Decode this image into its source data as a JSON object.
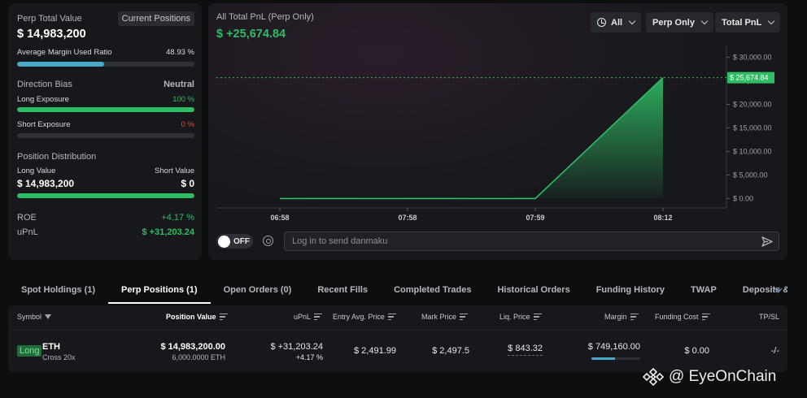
{
  "left_panel": {
    "perp_total_label": "Perp Total Value",
    "current_positions_btn": "Current Positions",
    "perp_total_value": "$ 14,983,200",
    "margin_label": "Average Margin Used Ratio",
    "margin_value": "48.93 %",
    "margin_ratio": 0.4893,
    "direction_bias_label": "Direction Bias",
    "direction_bias_value": "Neutral",
    "long_exposure_label": "Long Exposure",
    "long_exposure_value": "100 %",
    "long_exposure_ratio": 1.0,
    "short_exposure_label": "Short Exposure",
    "short_exposure_value": "0 %",
    "short_exposure_ratio": 0.0,
    "position_distribution_label": "Position Distribution",
    "long_value_label": "Long Value",
    "short_value_label": "Short Value",
    "long_value": "$ 14,983,200",
    "short_value": "$ 0",
    "long_value_ratio": 1.0,
    "roe_label": "ROE",
    "roe_value": "+4.17 %",
    "upnl_label": "uPnL",
    "upnl_value": "$ +31,203.24"
  },
  "chart_panel": {
    "title": "All Total PnL (Perp Only)",
    "value": "$ +25,674.84",
    "filters": [
      {
        "label": "All",
        "icon": "clock-icon"
      },
      {
        "label": "Perp Only"
      },
      {
        "label": "Total PnL"
      }
    ],
    "current_marker_label": "$ 25,674.84",
    "toggle_label": "OFF",
    "danmaku_placeholder": "Log in to send danmaku"
  },
  "chart_data": {
    "type": "area",
    "x": [
      "06:58",
      "07:58",
      "07:59",
      "08:12"
    ],
    "series": [
      {
        "values": [
          0,
          0,
          0,
          25674.84
        ]
      }
    ],
    "y_ticks": [
      "$ 30,000.00",
      "$ 25,000.00",
      "$ 20,000.00",
      "$ 15,000.00",
      "$ 10,000.00",
      "$ 5,000.00",
      "$ 0.00"
    ],
    "y_tick_values": [
      30000,
      25000,
      20000,
      15000,
      10000,
      5000,
      0
    ],
    "x_ticks": [
      "06:58",
      "07:58",
      "07:59",
      "08:12"
    ],
    "ylim": [
      -2000,
      32500
    ],
    "current_value": 25674.84,
    "colors": {
      "line": "#2ebd63",
      "area": "#2ebd63"
    }
  },
  "tabs": [
    {
      "label": "Spot Holdings (1)",
      "active": false
    },
    {
      "label": "Perp Positions (1)",
      "active": true
    },
    {
      "label": "Open Orders (0)",
      "active": false
    },
    {
      "label": "Recent Fills",
      "active": false
    },
    {
      "label": "Completed Trades",
      "active": false
    },
    {
      "label": "Historical Orders",
      "active": false
    },
    {
      "label": "Funding History",
      "active": false
    },
    {
      "label": "TWAP",
      "active": false
    },
    {
      "label": "Deposits & Withdrav",
      "active": false
    }
  ],
  "table": {
    "headers": {
      "symbol": "Symbol",
      "position_value": "Position Value",
      "upnl": "uPnL",
      "entry": "Entry Avg. Price",
      "mark": "Mark Price",
      "liq": "Liq. Price",
      "margin": "Margin",
      "funding": "Funding Cost",
      "tpsl": "TP/SL"
    },
    "row": {
      "side": "Long",
      "symbol": "ETH",
      "leverage": "Cross 20x",
      "position_value": "$ 14,983,200.00",
      "position_size": "6,000.0000 ETH",
      "upnl": "$ +31,203.24",
      "upnl_pct": "+4.17 %",
      "entry": "$ 2,491.99",
      "mark": "$ 2,497.5",
      "liq": "$ 843.32",
      "margin": "$ 749,160.00",
      "margin_ratio": 0.4893,
      "funding": "$ 0.00",
      "tpsl": "-/-"
    }
  },
  "watermark": {
    "text": "@ EyeOnChain",
    "icon": "binance-logo-icon"
  }
}
